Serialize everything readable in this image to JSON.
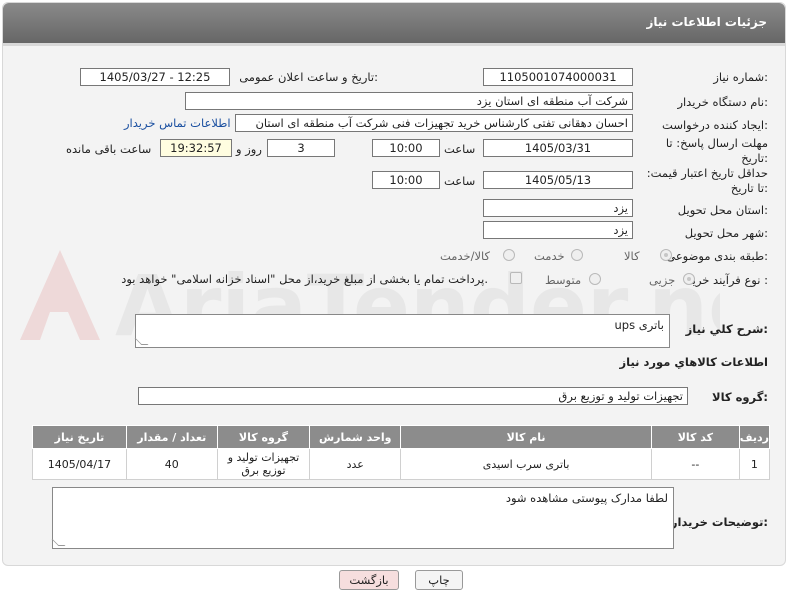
{
  "header": {
    "title": "جزئیات اطلاعات نیاز"
  },
  "fields": {
    "need_number_label": "شماره نیاز:",
    "need_number": "1105001074000031",
    "announce_label": "تاریخ و ساعت اعلان عمومی:",
    "announce_value": "1405/03/27 - 12:25",
    "buyer_label": "نام دستگاه خریدار:",
    "buyer_value": "شرکت آب منطقه ای استان یزد",
    "creator_label": "ایجاد کننده درخواست:",
    "creator_value": "احسان دهقانی تفتی کارشناس خرید تجهیزات فنی شرکت آب منطقه ای استان",
    "contact_link": "اطلاعات تماس خریدار",
    "reply_deadline_label": "مهلت ارسال پاسخ: تا تاریخ:",
    "reply_date": "1405/03/31",
    "time_label": "ساعت",
    "reply_time": "10:00",
    "days": "3",
    "days_label": "روز و",
    "remaining_time": "19:32:57",
    "remaining_label": "ساعت باقی مانده",
    "price_deadline_label": "حداقل تاریخ اعتبار قیمت: تا تاریخ:",
    "price_date": "1405/05/13",
    "price_time": "10:00",
    "province_label": "استان محل تحویل:",
    "province_value": "یزد",
    "city_label": "شهر محل تحویل:",
    "city_value": "یزد",
    "category_label": "طبقه بندی موضوعی:",
    "category_options": [
      "کالا",
      "خدمت",
      "کالا/خدمت"
    ],
    "process_label": "نوع فرآیند خرید :",
    "process_options": [
      "جزیی",
      "متوسط"
    ],
    "payment_note": "پرداخت تمام یا بخشی از مبلغ خرید،از محل \"اسناد خزانه اسلامی\" خواهد بود."
  },
  "description": {
    "label": "شرح کلي نياز:",
    "value": "باتری ups"
  },
  "goods": {
    "section_title": "اطلاعات کالاهاي مورد نياز",
    "group_label": "گروه کالا:",
    "group_value": "تجهیزات تولید و توزیع برق",
    "columns": [
      "رديف",
      "کد کالا",
      "نام کالا",
      "واحد شمارش",
      "گروه کالا",
      "تعداد / مقدار",
      "تاریخ نیاز"
    ],
    "rows": [
      [
        "1",
        "--",
        "باتری سرب اسیدی",
        "عدد",
        "تجهیزات تولید و توزیع برق",
        "40",
        "1405/04/17"
      ]
    ]
  },
  "buyer_notes": {
    "label": "توضیحات خریدار:",
    "value": "لطفا مدارک پیوستی مشاهده شود"
  },
  "buttons": {
    "print": "چاپ",
    "back": "بازگشت"
  },
  "watermark": {
    "text": "AriaTender.neT"
  },
  "colors": {
    "header": "#777777",
    "link": "#1a4fa0",
    "back_button": "#f6dede"
  }
}
